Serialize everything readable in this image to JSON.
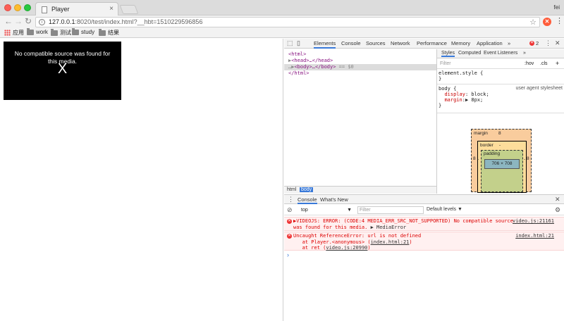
{
  "browser": {
    "tab_title": "Player",
    "user": "fei",
    "url_host": "127.0.0.1",
    "url_rest": ":8020/test/index.html?__hbt=1510229596856",
    "bookmarks": [
      "应用",
      "work",
      "测试",
      "study",
      "结果"
    ]
  },
  "page": {
    "player_message": "No compatible source was found for this media.",
    "player_close": "X"
  },
  "devtools": {
    "tabs": [
      "Elements",
      "Console",
      "Sources",
      "Network",
      "Performance",
      "Memory",
      "Application"
    ],
    "more": "»",
    "error_count": "2",
    "elements": {
      "l1": "<html>",
      "l2_open": "<head>",
      "l2_rest": "…</head>",
      "l3_open": "<body>",
      "l3_rest": "…</body>",
      "l3_note": "== $0",
      "l4": "</html>"
    },
    "breadcrumbs": [
      "html",
      "body"
    ],
    "styles": {
      "tabs": [
        "Styles",
        "Computed",
        "Event Listeners"
      ],
      "filter_placeholder": "Filter",
      "hov": ":hov",
      "cls": ".cls",
      "plus": "+",
      "rule1_selector": "element.style {",
      "rule1_close": "}",
      "rule2_selector": "body {",
      "rule2_source": "user agent stylesheet",
      "rule2_p1_name": "display",
      "rule2_p1_value": "block;",
      "rule2_p2_name": "margin",
      "rule2_p2_value": "8px;",
      "rule2_close": "}"
    },
    "boxmodel": {
      "margin_label": "margin",
      "margin_value": "8",
      "border_label": "border",
      "border_value": "-",
      "padding_label": "padding",
      "content": "706 × 708",
      "side_left": "8",
      "side_right": "8",
      "dash_l": "-",
      "dash_r": "-"
    },
    "console": {
      "tabs": [
        "Console",
        "What's New"
      ],
      "context": "top",
      "filter_placeholder": "Filter",
      "levels": "Default levels ▼",
      "messages": [
        {
          "line1": "▶VIDEOJS: ERROR: (CODE:4 MEDIA_ERR_SRC_NOT_SUPPORTED) No compatible source",
          "line2a": "was found for this media.",
          "line2b": "▶ MediaError",
          "source": "video.js:21161"
        },
        {
          "line1": "Uncaught ReferenceError: url is not defined",
          "line2a": "at Player.<anonymous> (",
          "line2b": "index.html:21",
          "line2c": ")",
          "line3a": "at ret (",
          "line3b": "video.js:20990",
          "line3c": ")",
          "source": "index.html:21"
        }
      ],
      "prompt": "›"
    }
  },
  "colors": {
    "accent": "#3879d9",
    "error": "#dd0000"
  }
}
